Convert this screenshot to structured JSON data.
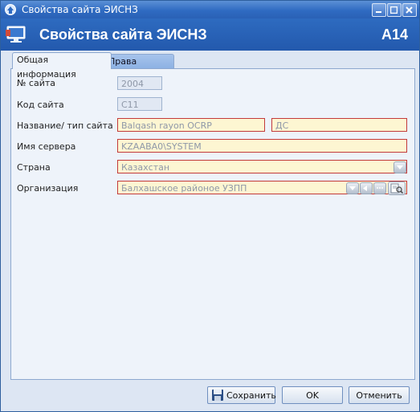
{
  "window": {
    "title": "Свойства сайта ЭИСНЗ"
  },
  "header": {
    "title": "Свойства сайта ЭИСНЗ",
    "code": "A14"
  },
  "tabs": [
    {
      "label": "Общая информация",
      "active": true
    },
    {
      "label": "Права доступа",
      "active": false
    }
  ],
  "form": {
    "site_number": {
      "label": "№ сайта",
      "value": "2004"
    },
    "site_code": {
      "label": "Код сайта",
      "value": "C11"
    },
    "site_name": {
      "label": "Название/ тип сайта",
      "value": "Balqash rayon OCRP",
      "type_value": "ДС"
    },
    "server_name": {
      "label": "Имя сервера",
      "value": "KZAABA0\\SYSTEM"
    },
    "country": {
      "label": "Страна",
      "value": "Казахстан"
    },
    "organization": {
      "label": "Организация",
      "value": "Балхашское районое УЗПП"
    }
  },
  "buttons": {
    "save": "Сохранить",
    "ok": "OK",
    "cancel": "Отменить"
  },
  "colors": {
    "titlebar": "#2f6bc2",
    "header": "#2359ad",
    "required_border": "#c33a3a",
    "required_fill": "#fdf6d2"
  }
}
